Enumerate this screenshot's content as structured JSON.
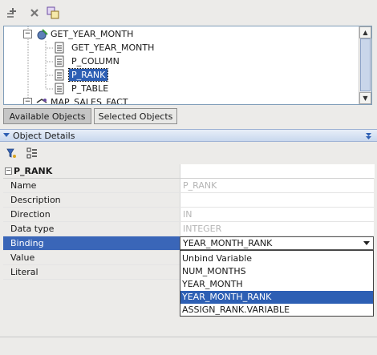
{
  "toolbar": {
    "icons": [
      "add-icon",
      "delete-icon",
      "copy-icon"
    ]
  },
  "tree": {
    "items": [
      {
        "label": "GET_YEAR_MONTH",
        "expander": "−",
        "icon": "function-icon"
      },
      {
        "label": "GET_YEAR_MONTH",
        "icon": "document-icon"
      },
      {
        "label": "P_COLUMN",
        "icon": "document-icon"
      },
      {
        "label": "P_RANK",
        "icon": "document-icon",
        "selected": true
      },
      {
        "label": "P_TABLE",
        "icon": "document-icon"
      },
      {
        "label": "MAP_SALES_FACT",
        "expander": "−",
        "icon": "mapping-icon"
      }
    ]
  },
  "tabs": [
    {
      "label": "Available Objects",
      "active": true
    },
    {
      "label": "Selected Objects",
      "active": false
    }
  ],
  "object_details": {
    "title": "Object Details",
    "section_expander": "−",
    "section_title": "P_RANK",
    "properties": [
      {
        "name": "Name",
        "value": "P_RANK",
        "disabled": true
      },
      {
        "name": "Description",
        "value": "",
        "disabled": false
      },
      {
        "name": "Direction",
        "value": "IN",
        "disabled": true
      },
      {
        "name": "Data type",
        "value": "INTEGER",
        "disabled": true
      },
      {
        "name": "Binding",
        "value": "YEAR_MONTH_RANK",
        "disabled": false
      },
      {
        "name": "Value",
        "value": "",
        "disabled": false
      },
      {
        "name": "Literal",
        "value": "",
        "disabled": false
      }
    ]
  },
  "binding_dropdown": {
    "selected": "YEAR_MONTH_RANK",
    "options": [
      "Unbind Variable",
      "NUM_MONTHS",
      "YEAR_MONTH",
      "YEAR_MONTH_RANK",
      "ASSIGN_RANK.VARIABLE"
    ]
  },
  "colors": {
    "selection": "#2d5fb4",
    "binding_row": "#3a66b8",
    "background": "#ecebe9"
  }
}
